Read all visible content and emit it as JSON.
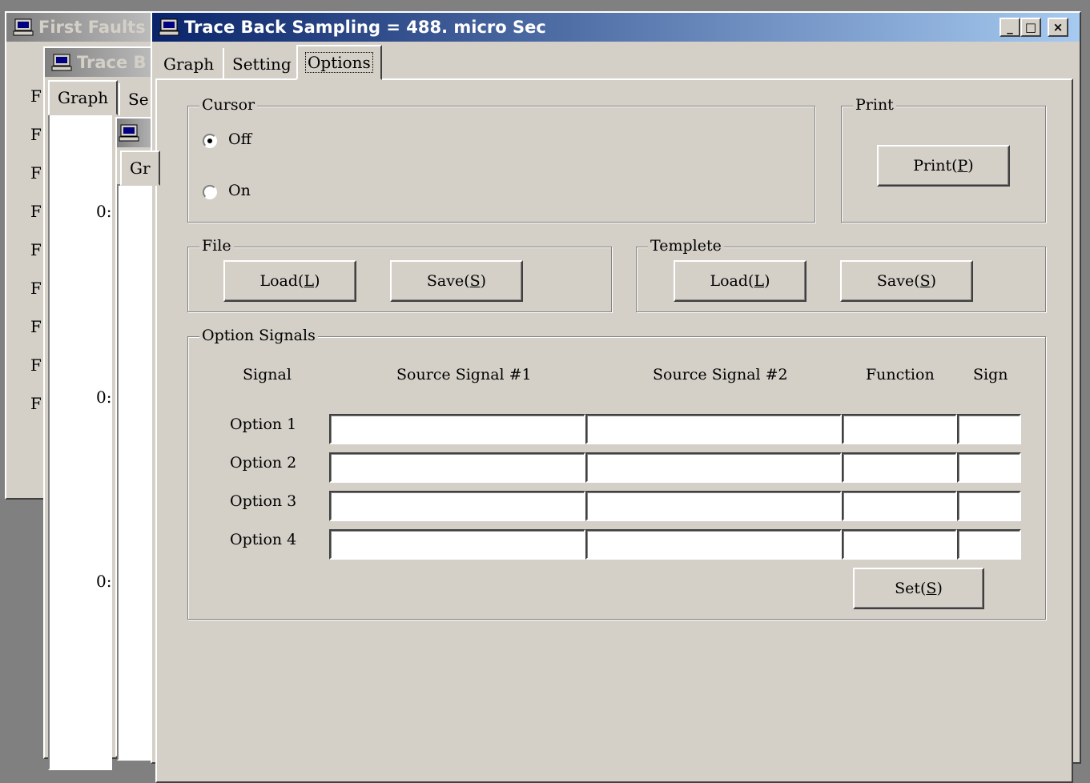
{
  "colors": {
    "face": "#d4d0c8",
    "active_title": "#0a246a",
    "inactive_title": "#808080"
  },
  "bg_window_1": {
    "title": "First Faults",
    "row_letters": [
      "F",
      "F",
      "F",
      "F",
      "F",
      "F",
      "F",
      "F",
      "F"
    ]
  },
  "bg_window_2": {
    "title": "Trace B",
    "tabs": [
      "Graph",
      "Se"
    ],
    "axis_labels": [
      "0:",
      "0:",
      "0:"
    ]
  },
  "bg_window_3": {
    "tab": "Gr"
  },
  "main_window": {
    "title": "Trace Back Sampling = 488. micro Sec",
    "title_icon": "computer-icon",
    "controls": {
      "minimize": "_",
      "maximize": "□",
      "close": "×"
    },
    "tabs": [
      {
        "label": "Graph"
      },
      {
        "label": "Setting"
      },
      {
        "label": "Options",
        "selected": true
      }
    ],
    "cursor_group": {
      "title": "Cursor",
      "off_label": "Off",
      "on_label": "On",
      "selected": "Off"
    },
    "print_group": {
      "title": "Print",
      "button_pre": "Print(",
      "button_key": "P",
      "button_post": ")"
    },
    "file_group": {
      "title": "File",
      "load_pre": "Load(",
      "load_key": "L",
      "load_post": ")",
      "save_pre": "Save(",
      "save_key": "S",
      "save_post": ")"
    },
    "template_group": {
      "title": "Templete",
      "load_pre": "Load(",
      "load_key": "L",
      "load_post": ")",
      "save_pre": "Save(",
      "save_key": "S",
      "save_post": ")"
    },
    "option_signals": {
      "title": "Option Signals",
      "headers": {
        "signal": "Signal",
        "source1": "Source Signal #1",
        "source2": "Source Signal #2",
        "function": "Function",
        "sign": "Sign"
      },
      "rows": [
        {
          "label": "Option 1",
          "source1": "",
          "source2": "",
          "function": "",
          "sign": ""
        },
        {
          "label": "Option 2",
          "source1": "",
          "source2": "",
          "function": "",
          "sign": ""
        },
        {
          "label": "Option 3",
          "source1": "",
          "source2": "",
          "function": "",
          "sign": ""
        },
        {
          "label": "Option 4",
          "source1": "",
          "source2": "",
          "function": "",
          "sign": ""
        }
      ],
      "set_pre": "Set(",
      "set_key": "S",
      "set_post": ")"
    }
  }
}
